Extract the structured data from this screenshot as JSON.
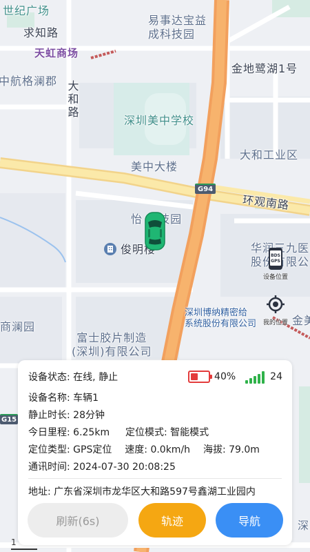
{
  "map": {
    "labels": {
      "shiji_guangchang": "世纪广场",
      "qiuzhi_road": "求知路",
      "tianhong": "天虹商场",
      "yishida": "易事达宝益\n成科技园",
      "jindi": "金地鹭湖1号",
      "zhonghang": "中航格澜郡",
      "dahe_road": "大和路",
      "meizhong_school": "深圳美中学校",
      "meizhong_building": "美中大楼",
      "dahe_industrial": "大和工业区",
      "huanguan_road": "环观南路",
      "yi_tech": "怡 科技园",
      "junming": "俊明楼",
      "huarun": "华润三九医药\n股份有限公司",
      "bona": "深圳博纳精密给\n系统股份有限公司",
      "jinmei": "金美",
      "shanglan": "商澜园",
      "fushi": "富士胶片制造\n(深圳)有限公司",
      "shen": "深",
      "g94": "G94",
      "g15": "G15",
      "scale": "1"
    },
    "controls": {
      "device_location": "设备位置",
      "my_location": "我的位置",
      "device_icon_text": "BDS\nGPS"
    }
  },
  "panel": {
    "status_label": "设备状态:",
    "status_value": "在线, 静止",
    "battery_text": "40%",
    "battery_level": 0.4,
    "signal_value": "24",
    "name_label": "设备名称:",
    "name_value": "车辆1",
    "still_label": "静止时长:",
    "still_value": "28分钟",
    "mileage_label": "今日里程:",
    "mileage_value": "6.25km",
    "mode_label": "定位模式:",
    "mode_value": "智能模式",
    "type_label": "定位类型:",
    "type_value": "GPS定位",
    "speed_label": "速度:",
    "speed_value": "0.0km/h",
    "altitude_label": "海拔:",
    "altitude_value": "79.0m",
    "time_label": "通讯时间:",
    "time_value": "2024-07-30 20:08:25",
    "address_label": "地址:",
    "address_value": "广东省深圳市龙华区大和路597号鑫湖工业园内",
    "refresh_label": "刷新(6s)",
    "track_label": "轨迹",
    "nav_label": "导航"
  },
  "colors": {
    "battery": "#e33b3b",
    "signal": "#2fb24a",
    "track_button": "#f5a712",
    "nav_button": "#3a8ff5",
    "car": "#1fb673"
  }
}
